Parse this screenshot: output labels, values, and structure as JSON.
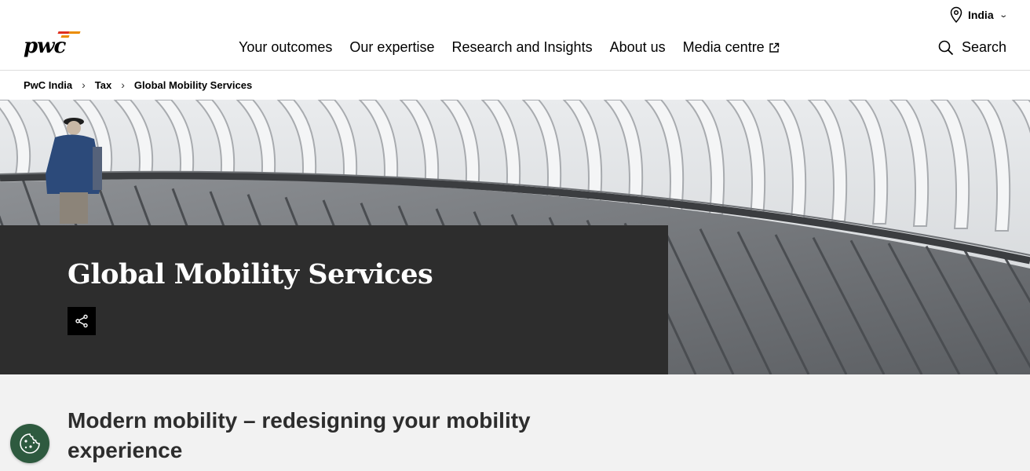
{
  "header": {
    "logo_text": "pwc",
    "region": "India",
    "nav": [
      {
        "label": "Your outcomes"
      },
      {
        "label": "Our expertise"
      },
      {
        "label": "Research and Insights"
      },
      {
        "label": "About us"
      },
      {
        "label": "Media centre",
        "external": true
      }
    ],
    "search_label": "Search"
  },
  "breadcrumb": [
    "PwC India",
    "Tax",
    "Global Mobility Services"
  ],
  "hero": {
    "title": "Global Mobility Services",
    "share_icon": "share-icon"
  },
  "intro": {
    "heading": "Modern mobility – redesigning your mobility experience"
  },
  "colors": {
    "brand_orange": "#e0301e",
    "brand_amber": "#eb8c00",
    "hero_panel": "#2d2d2d",
    "section_bg": "#f2f2f2",
    "cookie_green": "#2e5a3f"
  }
}
